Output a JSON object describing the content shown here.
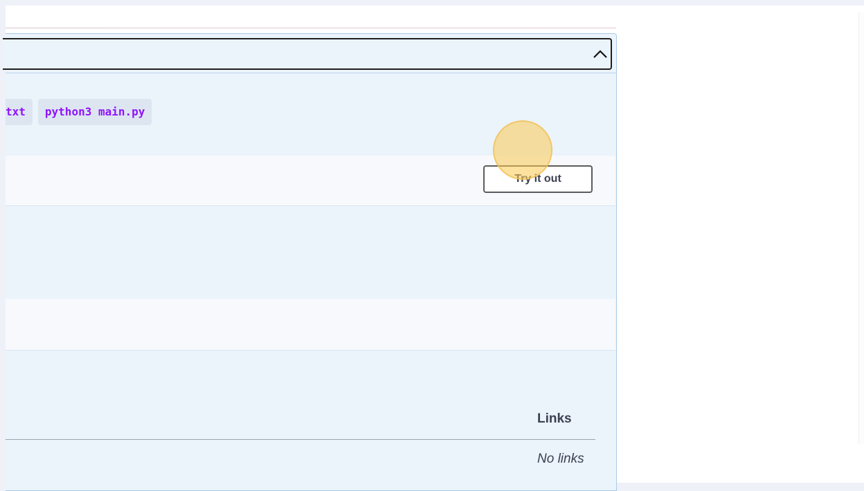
{
  "operation": {
    "commands": [
      "txt",
      "python3 main.py"
    ],
    "try_button": {
      "label": "Try it out"
    }
  },
  "responses": {
    "links_column_header": "Links",
    "no_links_text": "No links"
  }
}
